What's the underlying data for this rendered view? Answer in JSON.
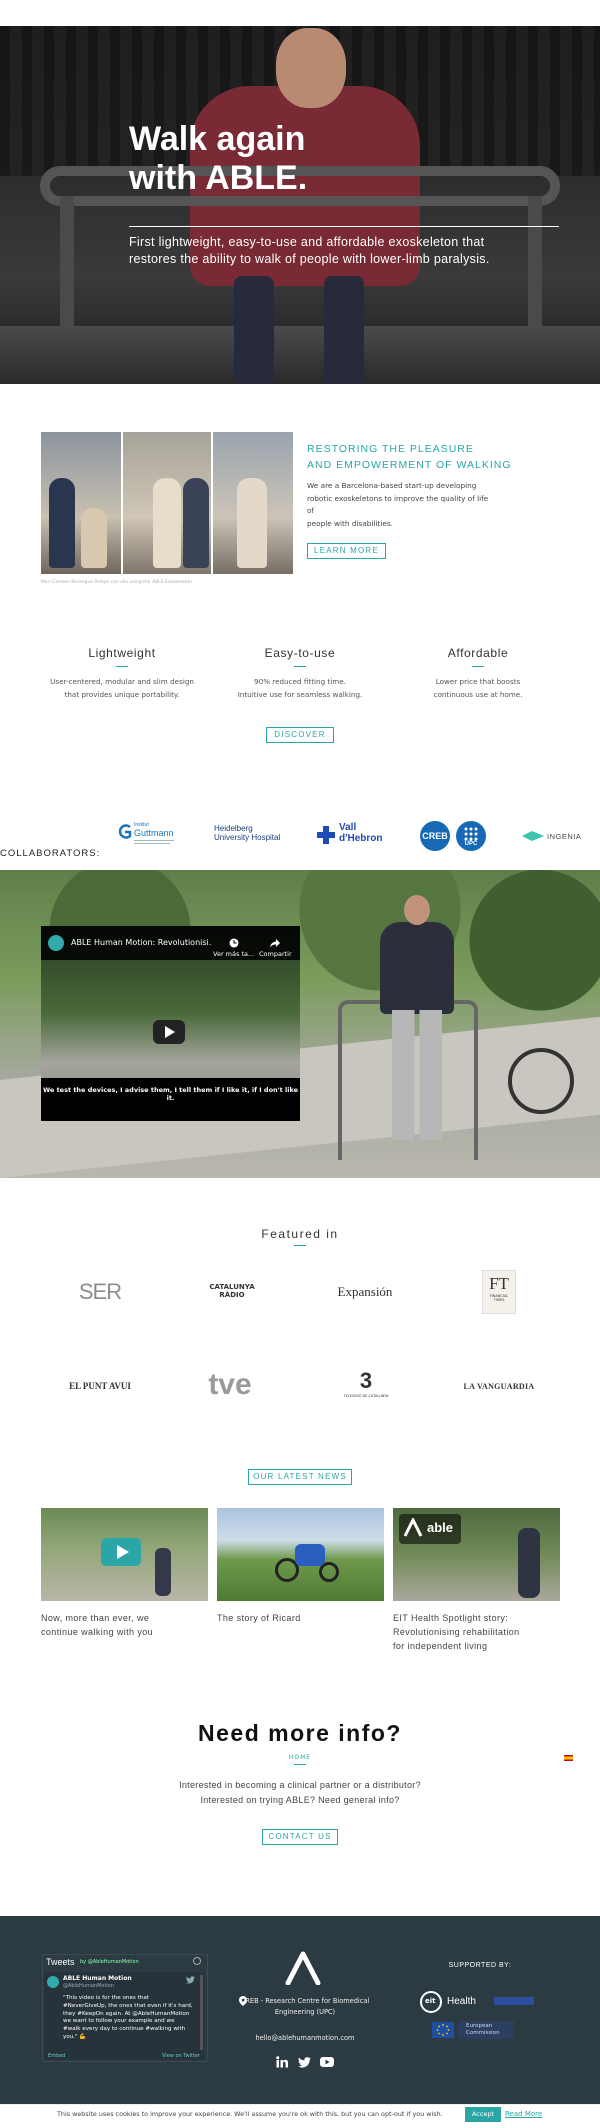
{
  "hero": {
    "title_line1": "Walk again",
    "title_line2": "with ABLE.",
    "subtitle_line1": "First lightweight, easy-to-use and affordable exoskeleton that",
    "subtitle_line2": "restores the ability to walk of people with lower-limb paralysis."
  },
  "about": {
    "heading_line1": "RESTORING THE PLEASURE",
    "heading_line2": "AND EMPOWERMENT OF WALKING",
    "text_line1": "We are a Barcelona-based start-up developing",
    "text_line2": "robotic exoskeletons to improve the quality of life of",
    "text_line3": "people with disabilities.",
    "button": "LEARN MORE",
    "photo_caption": "Mari Carmen Berengue Pelayo con ella using the ABLE Exoskeleton"
  },
  "features": [
    {
      "title": "Lightweight",
      "line1": "User-centered, modular and slim design",
      "line2": "that provides unique portability."
    },
    {
      "title": "Easy-to-use",
      "line1": "90% reduced fitting time.",
      "line2": "Intuitive use for seamless walking."
    },
    {
      "title": "Affordable",
      "line1": "Lower price that boosts",
      "line2": "continuous use at home."
    }
  ],
  "discover_button": "DISCOVER",
  "collaborators": {
    "label": "COLLABORATORS:",
    "guttmann_1": "Institut",
    "guttmann_2": "Guttmann",
    "heidelberg_1": "Heidelberg",
    "heidelberg_2": "University Hospital",
    "vall_1": "Vall",
    "vall_2": "d'Hebron",
    "creb": "CREB",
    "upc": "UPC",
    "ingenia": "INGENIA"
  },
  "video": {
    "title": "ABLE Human Motion: Revolutionisi...",
    "watch_later": "Ver más ta...",
    "share": "Compartir",
    "subtitle": "We test the devices, I advise them, I tell them if I like it, if I don't like it."
  },
  "featured": {
    "title": "Featured in",
    "ser": "SER",
    "catalunya_1": "CATALUNYA",
    "catalunya_2": "RÀDIO",
    "expansion": "Expansión",
    "ft": "FT",
    "ft_sub_1": "FINANCIAL",
    "ft_sub_2": "TIMES",
    "elpunt": "EL PUNT AVUI",
    "tve": "tve",
    "tv3": "3",
    "tv3_sub": "TELEVISIÓ DE CATALUNYA",
    "lavanguardia": "LA VANGUARDIA"
  },
  "news": {
    "button": "OUR LATEST NEWS",
    "items": [
      {
        "line1": "Now, more than ever, we",
        "line2": "continue walking with you"
      },
      {
        "line1": "The story of Ricard",
        "line2": ""
      },
      {
        "line1": "EIT Health Spotlight story:",
        "line2": "Revolutionising rehabilitation",
        "line3": "for independent living"
      }
    ],
    "able_badge": "able"
  },
  "info": {
    "title": "Need more info?",
    "home": "HOME",
    "line1": "Interested in becoming a clinical partner or a distributor?",
    "line2": "Interested on trying ABLE? Need general info?",
    "button": "CONTACT US"
  },
  "footer": {
    "tweets_label": "Tweets",
    "tweets_by": "by @AbleHumanMotion",
    "tweet_name": "ABLE Human Motion",
    "tweet_handle": "@AbleHumanMotion",
    "tweet_text": "\"This video is for the ones that #NeverGiveUp, the ones that even if it's hard, they #KeepOn again. At @AbleHumanMotion we want to follow your example and we #walk every day to continue #walking with you.\" 💪",
    "embed": "Embed",
    "view_on_twitter": "View on Twitter",
    "address_line1": "CREB - Research Centre for Biomedical",
    "address_line2": "Engineering (UPC)",
    "email": "hello@ablehumanmotion.com",
    "supported_by": "SUPPORTED BY:",
    "eit_health": "Health",
    "eu_1": "European",
    "eu_2": "Commission"
  },
  "cookie": {
    "text": "This website uses cookies to improve your experience. We'll assume you're ok with this, but you can opt-out if you wish.",
    "accept": "Accept",
    "read_more": "Read More"
  },
  "colors": {
    "accent": "#2aa6a6",
    "footer_bg": "#2c3a42"
  }
}
